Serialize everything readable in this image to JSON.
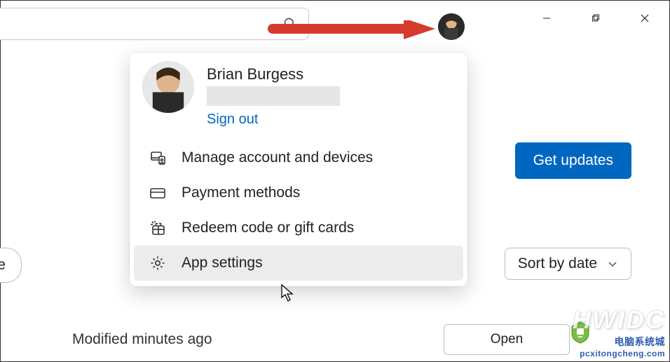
{
  "title_bar": {
    "search_placeholder": "Search"
  },
  "window_controls": {
    "minimize": "Minimize",
    "maximize": "Maximize",
    "close": "Close"
  },
  "user_menu": {
    "name": "Brian Burgess",
    "sign_out": "Sign out",
    "items": [
      {
        "icon": "account-devices-icon",
        "label": "Manage account and devices"
      },
      {
        "icon": "payment-icon",
        "label": "Payment methods"
      },
      {
        "icon": "redeem-icon",
        "label": "Redeem code or gift cards"
      },
      {
        "icon": "settings-icon",
        "label": "App settings"
      }
    ]
  },
  "body": {
    "get_updates": "Get updates",
    "filter_pill": "with device",
    "sort_label": "Sort by date",
    "modified_text": "Modified minutes ago",
    "open_button": "Open"
  },
  "watermark": {
    "large": "HWIDC",
    "small": "电脑系统城",
    "url": "pcxitongcheng.com"
  }
}
